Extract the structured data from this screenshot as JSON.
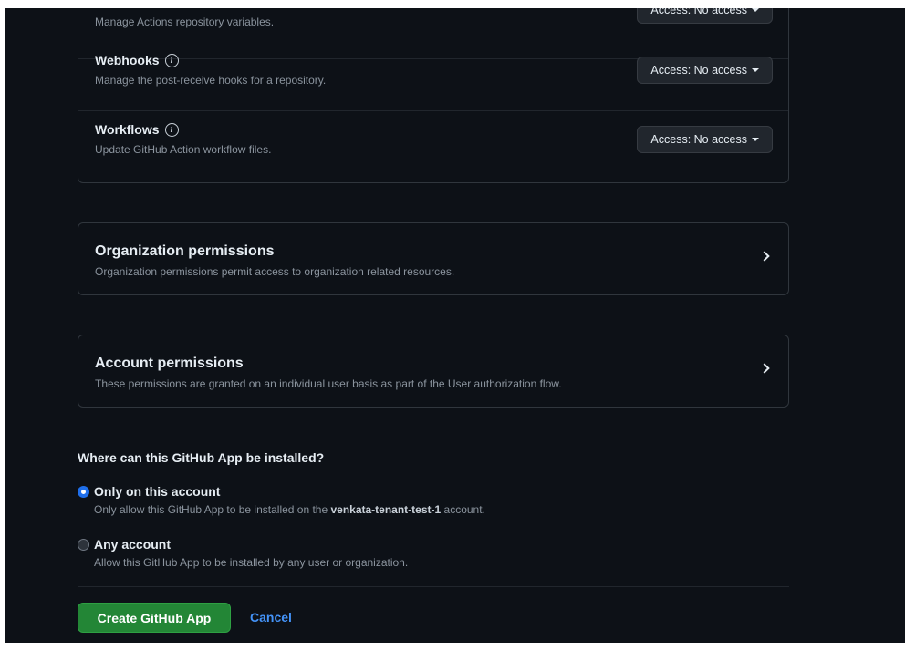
{
  "repo_permissions": [
    {
      "title": "",
      "description": "Manage Actions repository variables.",
      "access": "Access: No access"
    },
    {
      "title": "Webhooks",
      "description": "Manage the post-receive hooks for a repository.",
      "access": "Access: No access"
    },
    {
      "title": "Workflows",
      "description": "Update GitHub Action workflow files.",
      "access": "Access: No access"
    }
  ],
  "info_glyph": "i",
  "organization_permissions": {
    "title": "Organization permissions",
    "description": "Organization permissions permit access to organization related resources."
  },
  "account_permissions": {
    "title": "Account permissions",
    "description": "These permissions are granted on an individual user basis as part of the User authorization flow."
  },
  "install": {
    "question": "Where can this GitHub App be installed?",
    "options": [
      {
        "label": "Only on this account",
        "desc_prefix": "Only allow this GitHub App to be installed on the ",
        "desc_account": "venkata-tenant-test-1",
        "desc_suffix": " account.",
        "selected": true
      },
      {
        "label": "Any account",
        "description": "Allow this GitHub App to be installed by any user or organization.",
        "selected": false
      }
    ]
  },
  "actions": {
    "create_label": "Create GitHub App",
    "cancel_label": "Cancel"
  },
  "colors": {
    "background": "#0d1117",
    "primary_button": "#238636",
    "link": "#4493f8",
    "radio_selected": "#1f6feb"
  }
}
